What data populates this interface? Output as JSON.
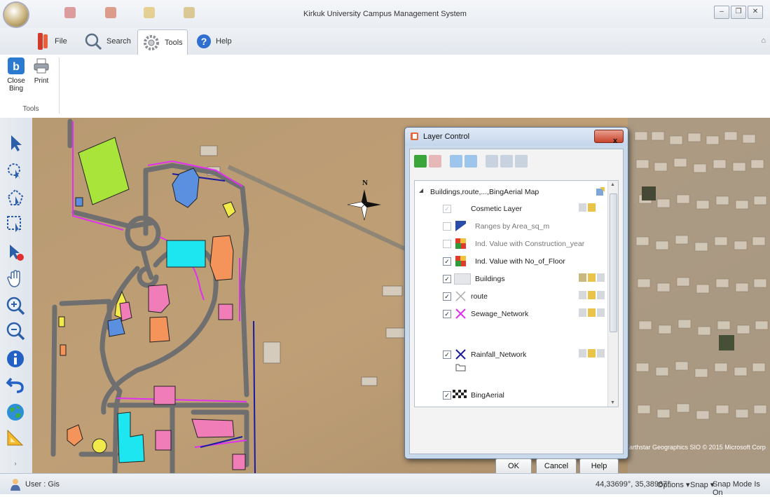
{
  "window": {
    "title": "Kirkuk University Campus Management System",
    "controls": [
      "minimize-icon",
      "restore-icon",
      "close-icon"
    ]
  },
  "ribbon": {
    "tabs": [
      {
        "label": "File",
        "icon": "file-icon"
      },
      {
        "label": "Search",
        "icon": "search-icon"
      },
      {
        "label": "Tools",
        "icon": "gear-icon",
        "active": true
      },
      {
        "label": "Help",
        "icon": "help-icon"
      }
    ],
    "tools_group": {
      "label": "Tools",
      "buttons": [
        {
          "label": "Close Bing",
          "icon": "bing-icon"
        },
        {
          "label": "Print",
          "icon": "printer-icon"
        }
      ]
    }
  },
  "left_toolbar": [
    "select-arrow-icon",
    "zoom-select-icon",
    "polygon-select-icon",
    "rectangle-select-icon",
    "select-clear-icon",
    "pan-hand-icon",
    "zoom-in-icon",
    "zoom-out-icon",
    "info-icon",
    "undo-icon",
    "globe-icon",
    "ruler-icon"
  ],
  "map": {
    "north_label": "N",
    "attribution": "Earthstar Geographics SIO © 2015 Microsoft Corp"
  },
  "layer_control": {
    "title": "Layer Control",
    "root": "Buildings,route,...,BingAerial Map",
    "layers": [
      {
        "name": "Cosmetic Layer",
        "checked": true,
        "disabled": true
      },
      {
        "name": "Ranges by Area_sq_m",
        "checked": false,
        "disabled": true
      },
      {
        "name": "Ind. Value with Construction_year",
        "checked": false,
        "disabled": true
      },
      {
        "name": "Ind. Value with No_of_Floor",
        "checked": true,
        "disabled": false
      },
      {
        "name": "Buildings",
        "checked": true,
        "disabled": false
      },
      {
        "name": "route",
        "checked": true,
        "disabled": false
      },
      {
        "name": "Sewage_Network",
        "checked": true,
        "disabled": false
      },
      {
        "name": "Rainfall_Network",
        "checked": true,
        "disabled": false
      },
      {
        "name": "BingAerial",
        "checked": true,
        "disabled": false
      }
    ],
    "buttons": {
      "ok": "OK",
      "cancel": "Cancel",
      "help": "Help"
    }
  },
  "status_bar": {
    "user": "User : Gis",
    "coordinates": "44,33699°, 35,38967°",
    "options": "Options ▾",
    "snap": "Snap ▾",
    "snap_mode": "Snap Mode Is On"
  },
  "colors": {
    "building_green": "#a8e43a",
    "building_blue": "#5b8fe0",
    "building_cyan": "#1ee6f0",
    "building_orange": "#f4935a",
    "building_pink": "#f07cb8",
    "building_yellow": "#f2ea4a",
    "road_gray": "#6f6f6f",
    "sewage_magenta": "#e030f0",
    "rainfall_blue": "#1a1aa0"
  }
}
